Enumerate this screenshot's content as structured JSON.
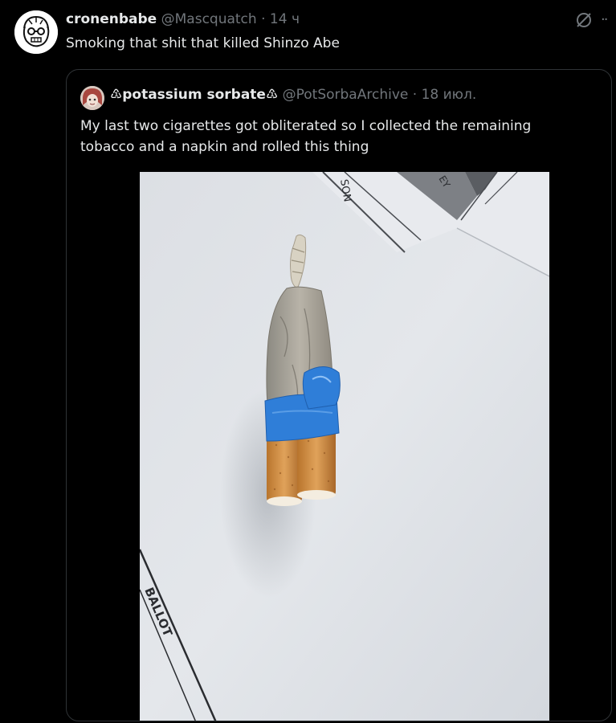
{
  "tweet": {
    "author": {
      "display_name": "cronenbabe",
      "handle": "@Mascquatch",
      "separator": "·",
      "time": "14 ч",
      "avatar_icon": "cartoon-face-avatar"
    },
    "text": "Smoking that shit that killed Shinzo Abe",
    "actions": {
      "grok_icon": "grok-icon",
      "more_icon": "more-icon",
      "more_label": "··"
    }
  },
  "quote": {
    "author": {
      "display_name": "♳potassium sorbate♳",
      "handle": "@PotSorbaArchive",
      "separator": "·",
      "time": "18 июл.",
      "avatar_icon": "anime-avatar"
    },
    "text_lines": [
      "My last two cigarettes got obliterated so I collected the remaining",
      "tobacco and a napkin and rolled this thing"
    ],
    "photo": {
      "ballot_text": "BALLOT",
      "top_text_1": "SON",
      "top_text_2": "EY"
    }
  },
  "colors": {
    "background": "#000000",
    "text_primary": "#e7e9ea",
    "text_secondary": "#71767b",
    "border": "#2f3336"
  }
}
